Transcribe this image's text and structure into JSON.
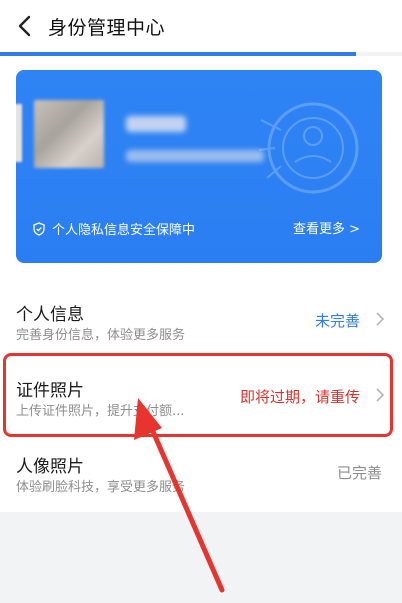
{
  "header": {
    "title": "身份管理中心",
    "back_icon": "chevron-left-icon"
  },
  "card": {
    "privacy_text": "个人隐私信息安全保障中",
    "more_text": "查看更多 >",
    "privacy_icon": "shield-icon",
    "accent_color": "#2f84f4"
  },
  "items": [
    {
      "title": "个人信息",
      "subtitle": "完善身份信息，体验更多服务",
      "status": "未完善",
      "status_color": "#2f7bea"
    },
    {
      "title": "证件照片",
      "subtitle": "上传证件照片，提升支付额...",
      "status": "即将过期，请重传",
      "status_color": "#d6332d"
    },
    {
      "title": "人像照片",
      "subtitle": "体验刷脸科技，享受更多服务",
      "status": "已完善",
      "status_color": "#8d8d8d"
    }
  ],
  "annotation": {
    "highlight_color": "#e7342f"
  }
}
